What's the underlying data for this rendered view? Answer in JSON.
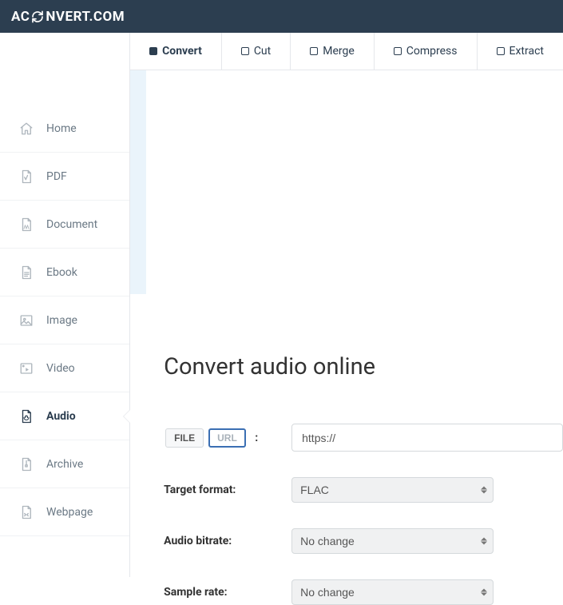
{
  "brand": {
    "pre": "AC",
    "post": "NVERT.COM"
  },
  "sidebar": [
    {
      "key": "home",
      "label": "Home",
      "icon": "home"
    },
    {
      "key": "pdf",
      "label": "PDF",
      "icon": "pdf"
    },
    {
      "key": "document",
      "label": "Document",
      "icon": "document"
    },
    {
      "key": "ebook",
      "label": "Ebook",
      "icon": "ebook"
    },
    {
      "key": "image",
      "label": "Image",
      "icon": "image"
    },
    {
      "key": "video",
      "label": "Video",
      "icon": "video"
    },
    {
      "key": "audio",
      "label": "Audio",
      "icon": "audio",
      "active": true
    },
    {
      "key": "archive",
      "label": "Archive",
      "icon": "archive"
    },
    {
      "key": "webpage",
      "label": "Webpage",
      "icon": "webpage"
    }
  ],
  "tabs": [
    {
      "label": "Convert",
      "active": true
    },
    {
      "label": "Cut"
    },
    {
      "label": "Merge"
    },
    {
      "label": "Compress"
    },
    {
      "label": "Extract"
    }
  ],
  "page": {
    "title": "Convert audio online",
    "source_toggle": {
      "file": "FILE",
      "url": "URL",
      "selected": "url",
      "colon": ":"
    },
    "url_value": "https://",
    "fields": {
      "target_format": {
        "label": "Target format:",
        "value": "FLAC"
      },
      "audio_bitrate": {
        "label": "Audio bitrate:",
        "value": "No change"
      },
      "sample_rate": {
        "label": "Sample rate:",
        "value": "No change"
      }
    }
  },
  "colors": {
    "header_bg": "#2c3e50",
    "accent": "#3b6fb3"
  }
}
